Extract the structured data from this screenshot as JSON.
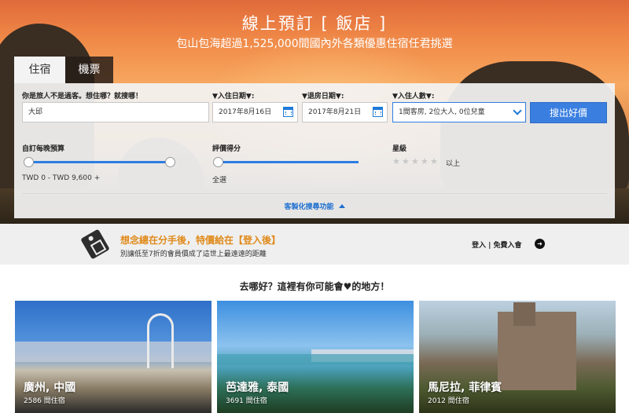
{
  "hero": {
    "title": "線上預訂 [ 飯店 ]",
    "subtitle": "包山包海超過1,525,000間國內外各類優惠住宿任君挑選"
  },
  "tabs": [
    {
      "label": "住宿",
      "active": true
    },
    {
      "label": "機票",
      "active": false
    }
  ],
  "search": {
    "destination_label": "你是旅人不是過客。想住哪？就搜哪！",
    "destination_value": "大邱",
    "checkin_label": "▼入住日期▼:",
    "checkin_value": "2017年8月16日",
    "checkout_label": "▼退房日期▼:",
    "checkout_value": "2017年8月21日",
    "guests_label": "▼入住人數▼:",
    "guests_value": "1間客房, 2位大人, 0位兒童",
    "search_button": "搜出好價",
    "budget_label": "自訂每晚預算",
    "budget_range": "TWD 0 - TWD 9,600 +",
    "rating_label": "評價得分",
    "rating_value": "全選",
    "star_label": "星級",
    "star_suffix": "以上",
    "advanced_link": "客製化搜尋功能"
  },
  "promo": {
    "title": "想念總在分手後，特價給在【登入後】",
    "subtitle": "別讓低至7折的會員價成了這世上最遠遠的距離",
    "login_text": "登入 | 免費入會"
  },
  "destinations": {
    "heading": "去哪好？這裡有你可能會♥的地方！",
    "cards": [
      {
        "name": "廣州, 中國",
        "count": "2586 間住宿"
      },
      {
        "name": "芭達雅, 泰國",
        "count": "3691 間住宿"
      },
      {
        "name": "馬尼拉, 菲律賓",
        "count": "2012 間住宿"
      }
    ]
  },
  "colors": {
    "accent": "#3a7fe0",
    "promo_orange": "#e08a1a"
  }
}
